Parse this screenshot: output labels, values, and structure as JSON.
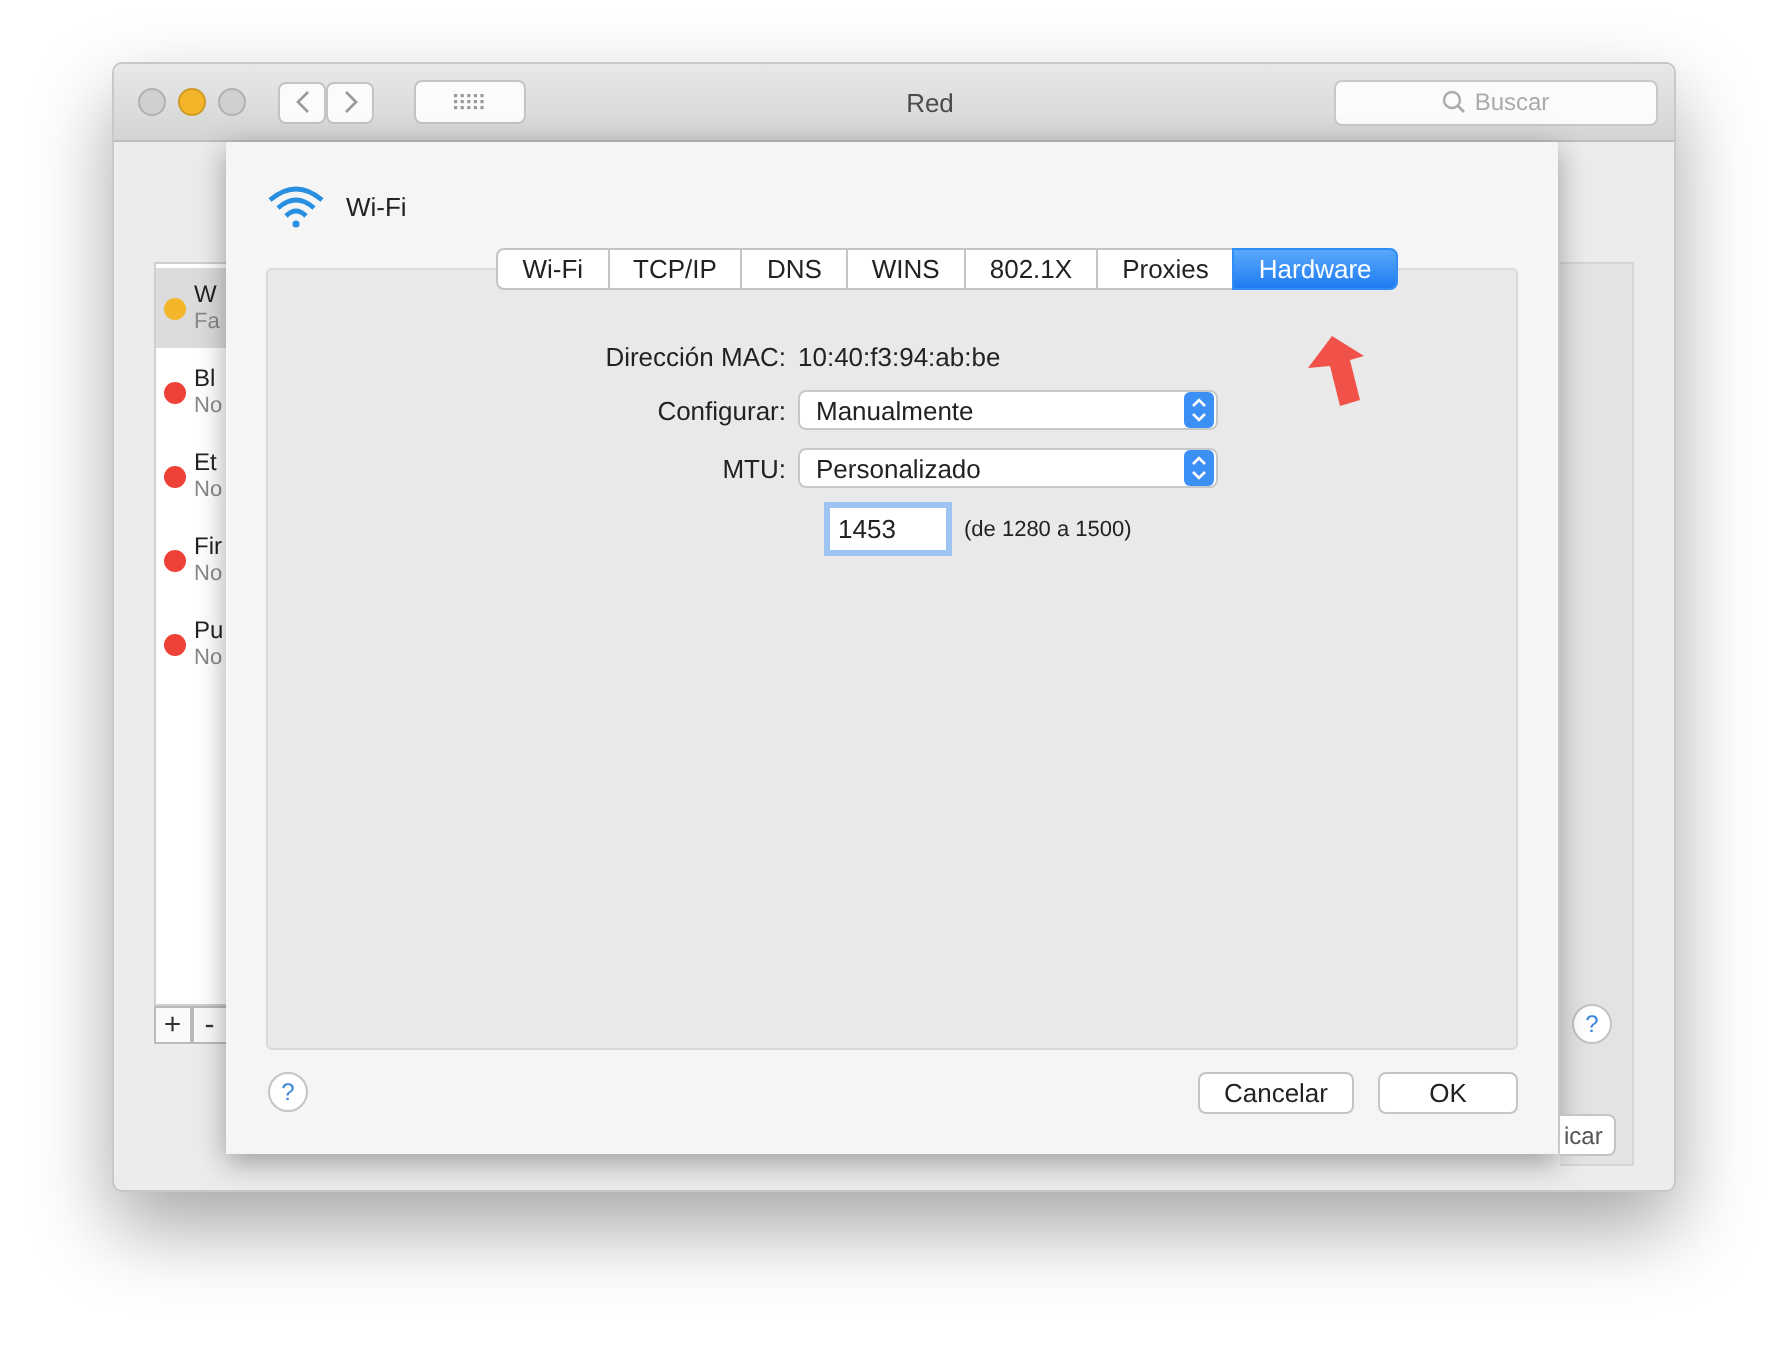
{
  "window": {
    "title": "Red",
    "search": {
      "placeholder": "Buscar"
    }
  },
  "sidebar": {
    "items": [
      {
        "name": "W",
        "status": "Fa",
        "color": "#f5b52a",
        "selected": true
      },
      {
        "name": "Bl",
        "status": "No",
        "color": "#ee4138",
        "selected": false
      },
      {
        "name": "Et",
        "status": "No",
        "color": "#ee4138",
        "selected": false
      },
      {
        "name": "Fir",
        "status": "No",
        "color": "#ee4138",
        "selected": false
      },
      {
        "name": "Pu",
        "status": "No",
        "color": "#ee4138",
        "selected": false
      }
    ],
    "buttons": [
      "+",
      "-"
    ]
  },
  "help": "?",
  "apply_button": "icar",
  "sheet": {
    "title": "Wi-Fi",
    "tabs": [
      {
        "label": "Wi-Fi",
        "selected": false
      },
      {
        "label": "TCP/IP",
        "selected": false
      },
      {
        "label": "DNS",
        "selected": false
      },
      {
        "label": "WINS",
        "selected": false
      },
      {
        "label": "802.1X",
        "selected": false
      },
      {
        "label": "Proxies",
        "selected": false
      },
      {
        "label": "Hardware",
        "selected": true
      }
    ],
    "fields": [
      {
        "kind": "text",
        "label": "Dirección MAC:",
        "value": "10:40:f3:94:ab:be"
      },
      {
        "kind": "popup",
        "label": "Configurar:",
        "value": "Manualmente"
      },
      {
        "kind": "popup",
        "label": "MTU:",
        "value": "Personalizado"
      },
      {
        "kind": "input",
        "value": "1453",
        "hint": "(de 1280 a 1500)"
      }
    ],
    "help": "?",
    "buttons": [
      "Cancelar",
      "OK"
    ]
  }
}
